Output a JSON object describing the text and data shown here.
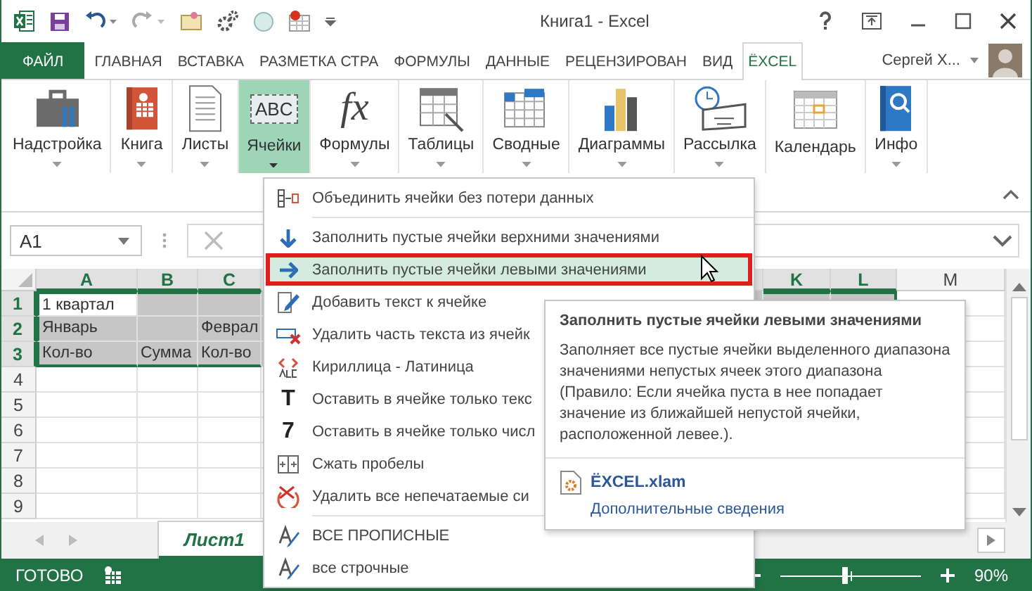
{
  "window": {
    "title": "Книга1 - Excel"
  },
  "tabs": [
    {
      "label": "ФАЙЛ",
      "kind": "file",
      "selected": false
    },
    {
      "label": "ГЛАВНАЯ",
      "kind": "tab",
      "selected": false
    },
    {
      "label": "ВСТАВКА",
      "kind": "tab",
      "selected": false
    },
    {
      "label": "РАЗМЕТКА СТРА",
      "kind": "tab",
      "selected": false
    },
    {
      "label": "ФОРМУЛЫ",
      "kind": "tab",
      "selected": false
    },
    {
      "label": "ДАННЫЕ",
      "kind": "tab",
      "selected": false
    },
    {
      "label": "РЕЦЕНЗИРОВАН",
      "kind": "tab",
      "selected": false
    },
    {
      "label": "ВИД",
      "kind": "tab",
      "selected": false
    },
    {
      "label": "ЁXCEL",
      "kind": "tab",
      "selected": true
    }
  ],
  "user": {
    "name": "Сергей Х..."
  },
  "ribbon": [
    {
      "label": "Надстройка",
      "dropdown": true,
      "selected": false
    },
    {
      "label": "Книга",
      "dropdown": true,
      "selected": false
    },
    {
      "label": "Листы",
      "dropdown": true,
      "selected": false
    },
    {
      "label": "Ячейки",
      "dropdown": true,
      "selected": true,
      "glyph": "ABC"
    },
    {
      "label": "Формулы",
      "dropdown": true,
      "selected": false,
      "glyph": "fx"
    },
    {
      "label": "Таблицы",
      "dropdown": true,
      "selected": false
    },
    {
      "label": "Сводные",
      "dropdown": true,
      "selected": false
    },
    {
      "label": "Диаграммы",
      "dropdown": true,
      "selected": false
    },
    {
      "label": "Рассылка",
      "dropdown": true,
      "selected": false
    },
    {
      "label": "Календарь",
      "dropdown": false,
      "selected": false
    },
    {
      "label": "Инфо",
      "dropdown": true,
      "selected": false
    }
  ],
  "name_box": {
    "value": "A1"
  },
  "sheet": {
    "columns": [
      {
        "label": "A",
        "selected": true
      },
      {
        "label": "B",
        "selected": true
      },
      {
        "label": "C",
        "selected": true
      },
      {
        "label": "K",
        "selected": true
      },
      {
        "label": "L",
        "selected": true
      },
      {
        "label": "M",
        "selected": false
      }
    ],
    "rows": [
      {
        "number": "1",
        "selected": true,
        "cells": [
          "1 квартал",
          null,
          null
        ]
      },
      {
        "number": "2",
        "selected": true,
        "cells": [
          "Январь",
          null,
          "Феврал"
        ]
      },
      {
        "number": "3",
        "selected": true,
        "cells": [
          "Кол-во",
          "Сумма",
          "Кол-во"
        ]
      },
      {
        "number": "4",
        "selected": false,
        "cells": [
          null,
          null,
          null
        ]
      },
      {
        "number": "5",
        "selected": false,
        "cells": [
          null,
          null,
          null
        ]
      },
      {
        "number": "6",
        "selected": false,
        "cells": [
          null,
          null,
          null
        ]
      },
      {
        "number": "7",
        "selected": false,
        "cells": [
          null,
          null,
          null
        ]
      },
      {
        "number": "8",
        "selected": false,
        "cells": [
          null,
          null,
          null
        ]
      },
      {
        "number": "9",
        "selected": false,
        "cells": [
          null,
          null,
          null
        ]
      }
    ]
  },
  "sheet_tabs": [
    {
      "label": "Лист1",
      "selected": true
    }
  ],
  "status_bar": {
    "status": "ГОТОВО",
    "zoom": {
      "level": 0.46,
      "reading": "90%"
    }
  },
  "menu": {
    "items": [
      {
        "kind": "item",
        "label": "Объединить ячейки без потери данных",
        "selected": false
      },
      {
        "kind": "separator"
      },
      {
        "kind": "item",
        "label": "Заполнить пустые ячейки верхними значениями",
        "selected": false
      },
      {
        "kind": "item",
        "label": "Заполнить пустые ячейки левыми значениями",
        "selected": true
      },
      {
        "kind": "item",
        "label": "Добавить текст к ячейке",
        "selected": false
      },
      {
        "kind": "item",
        "label": "Удалить часть текста из ячейк",
        "selected": false
      },
      {
        "kind": "item",
        "label": "Кириллица - Латиница",
        "selected": false
      },
      {
        "kind": "item",
        "label": "Оставить в ячейке только текс",
        "selected": false,
        "glyph": "T"
      },
      {
        "kind": "item",
        "label": "Оставить в ячейке только числ",
        "selected": false,
        "glyph": "7"
      },
      {
        "kind": "item",
        "label": "Сжать пробелы",
        "selected": false
      },
      {
        "kind": "item",
        "label": "Удалить все непечатаемые си",
        "selected": false
      },
      {
        "kind": "separator"
      },
      {
        "kind": "item",
        "label": "ВСЕ ПРОПИСНЫЕ",
        "selected": false
      },
      {
        "kind": "item",
        "label": "все строчные",
        "selected": false
      }
    ]
  },
  "tooltip": {
    "title": "Заполнить пустые ячейки левыми значениями",
    "description": "Заполняет все пустые ячейки выделенного диапазона значениями непустых ячеек этого диапазона (Правило: Если ячейка пуста в нее попадает значение из ближайшей непустой ячейки, расположенной левее.).",
    "addin": "ЁXCEL.xlam",
    "link": "Дополнительные сведения"
  }
}
